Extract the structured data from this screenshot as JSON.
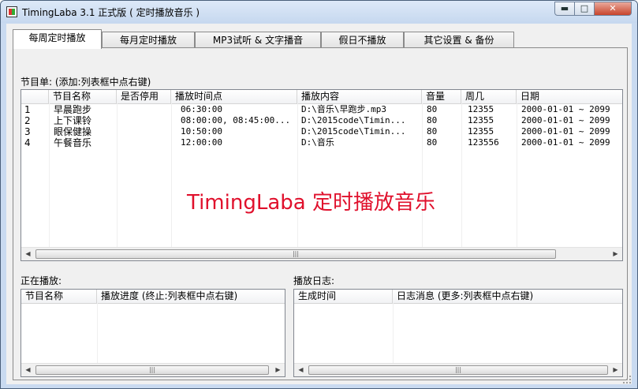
{
  "window": {
    "title": "TimingLaba 3.1 正式版 ( 定时播放音乐 )",
    "controls": {
      "minimize": "▬",
      "maximize": "□",
      "close": "✕"
    }
  },
  "tabs": [
    {
      "label": "每周定时播放",
      "active": true
    },
    {
      "label": "每月定时播放",
      "active": false
    },
    {
      "label": "MP3试听 & 文字播音",
      "active": false
    },
    {
      "label": "假日不播放",
      "active": false
    },
    {
      "label": "其它设置 & 备份",
      "active": false
    }
  ],
  "schedule": {
    "label": "节目单: (添加:列表框中点右键)",
    "columns": [
      "",
      "节目名称",
      "是否停用",
      "播放时间点",
      "播放内容",
      "音量",
      "周几",
      "日期"
    ],
    "rows": [
      [
        "1",
        "早晨跑步",
        "",
        "06:30:00",
        "D:\\音乐\\早跑步.mp3",
        "80",
        "12355",
        "2000-01-01 ~ 2099"
      ],
      [
        "2",
        "上下课铃",
        "",
        "08:00:00, 08:45:00...",
        "D:\\2015code\\Timin...",
        "80",
        "12355",
        "2000-01-01 ~ 2099"
      ],
      [
        "3",
        "眼保健操",
        "",
        "10:50:00",
        "D:\\2015code\\Timin...",
        "80",
        "12355",
        "2000-01-01 ~ 2099"
      ],
      [
        "4",
        "午餐音乐",
        "",
        "12:00:00",
        "D:\\音乐",
        "80",
        "123556",
        "2000-01-01 ~ 2099"
      ]
    ],
    "watermark": "TimingLaba 定时播放音乐"
  },
  "now_playing": {
    "label": "正在播放:",
    "columns": [
      "节目名称",
      "播放进度 (终止:列表框中点右键)"
    ]
  },
  "log": {
    "label": "播放日志:",
    "columns": [
      "生成时间",
      "日志消息 (更多:列表框中点右键)"
    ]
  },
  "scroll": {
    "left": "◀",
    "right": "▶",
    "grip": "|||"
  }
}
